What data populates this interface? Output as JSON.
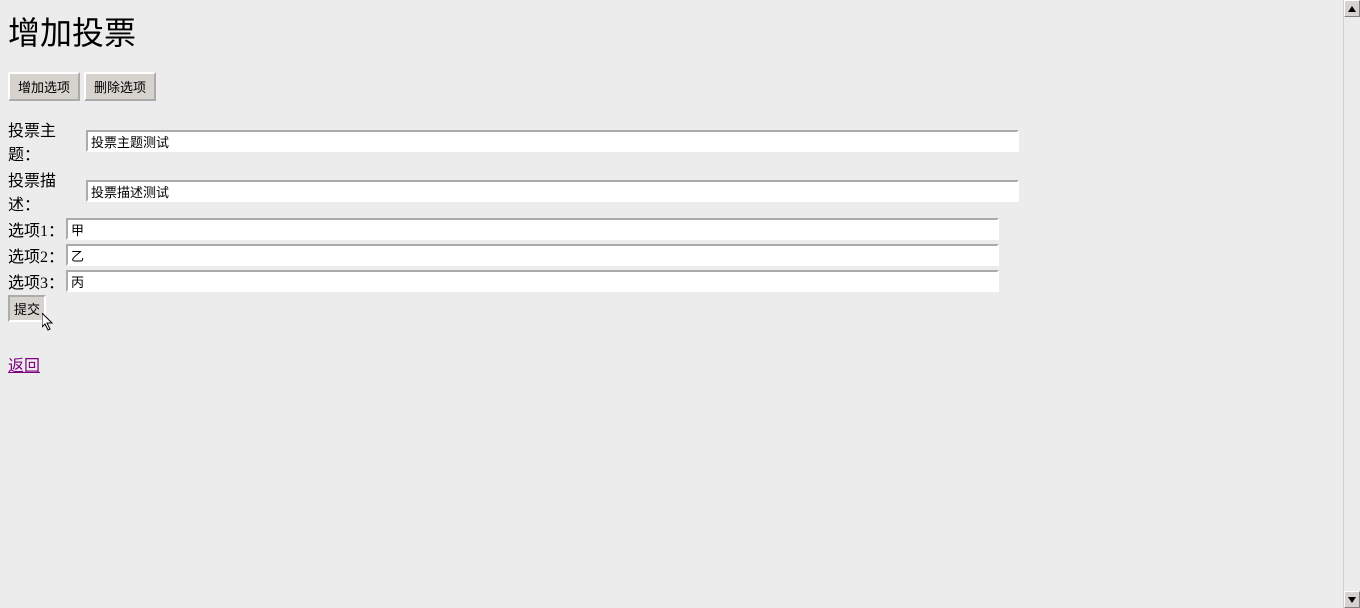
{
  "page": {
    "title": "增加投票",
    "add_option_label": "增加选项",
    "remove_option_label": "删除选项",
    "subject_label": "投票主题：",
    "description_label": "投票描述：",
    "subject_value": "投票主题测试",
    "description_value": "投票描述测试",
    "options": [
      {
        "label": "选项1：",
        "value": "甲"
      },
      {
        "label": "选项2：",
        "value": "乙"
      },
      {
        "label": "选项3：",
        "value": "丙"
      }
    ],
    "submit_label": "提交",
    "return_label": "返回"
  }
}
